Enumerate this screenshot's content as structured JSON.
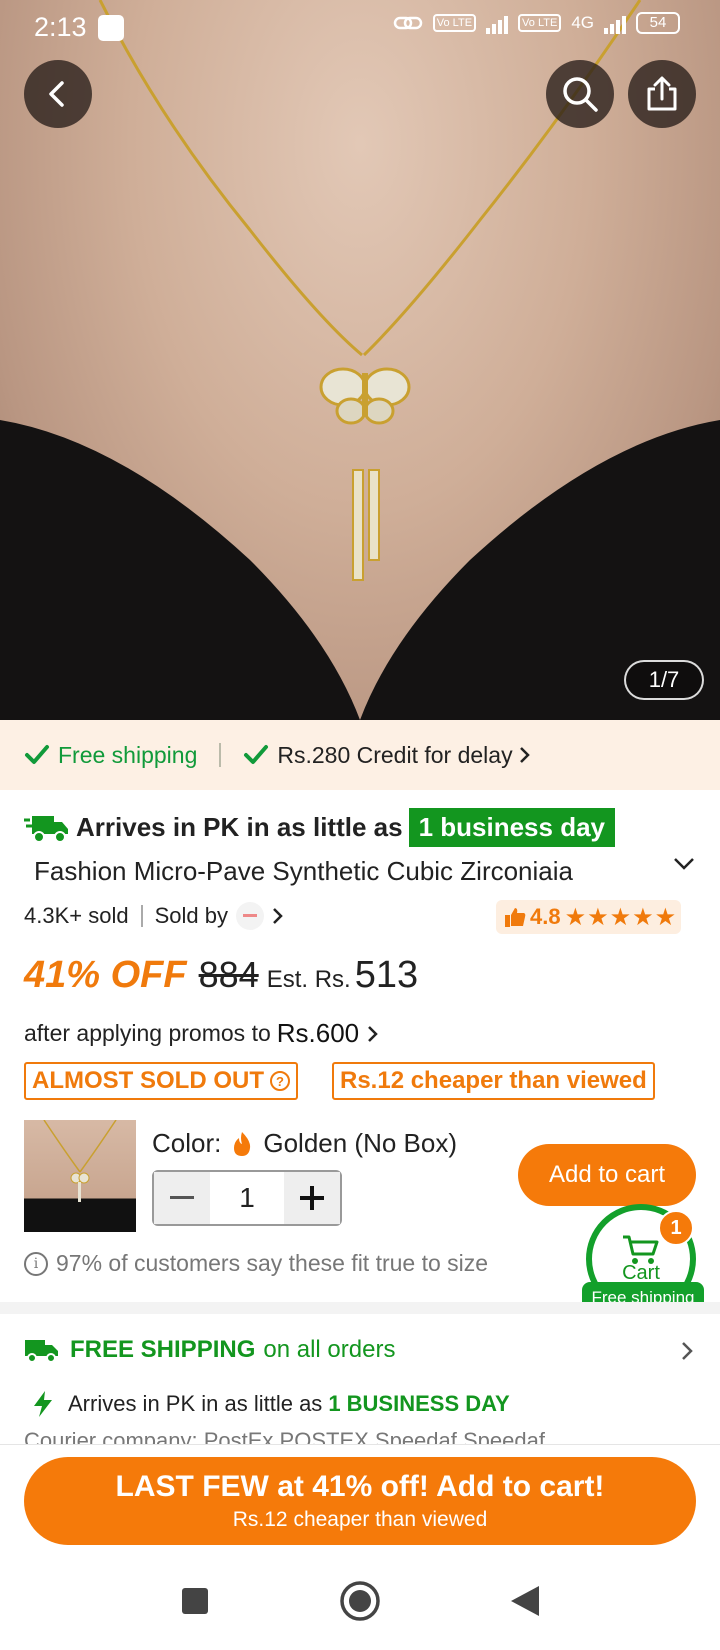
{
  "status_bar": {
    "time": "2:13",
    "battery": "54",
    "net_label_1": "Vo LTE",
    "net_label_2": "Vo LTE",
    "net_type": "4G"
  },
  "gallery": {
    "counter": "1/7"
  },
  "shipping_strip": {
    "free_shipping": "Free shipping",
    "credit": "Rs.280 Credit for delay"
  },
  "product": {
    "arrives_text": "Arrives in PK in as little as",
    "arrives_badge": "1 business day",
    "title": "Fashion Micro-Pave Synthetic Cubic Zirconiaia",
    "sold_count": "4.3K+ sold",
    "sold_by": "Sold by",
    "rating": "4.8",
    "stars": "★★★★★",
    "discount": "41% OFF",
    "original_price": "884",
    "est_label": "Est. Rs.",
    "current_price": "513",
    "promo_text": "after applying promos to",
    "promo_price": "Rs.600",
    "badge_almost": "ALMOST SOLD OUT",
    "badge_cheaper": "Rs.12 cheaper than viewed",
    "color_label": "Color:",
    "color_value": "Golden (No Box)",
    "quantity": "1",
    "add_to_cart": "Add to cart",
    "fit_note": "97% of customers say these fit true to size"
  },
  "cart": {
    "label": "Cart",
    "count": "1",
    "free_shipping": "Free shipping"
  },
  "shipping_section": {
    "free_bold": "FREE SHIPPING",
    "free_rest": "on all orders",
    "arrive_text": "Arrives in PK in as little as",
    "arrive_bold": "1 BUSINESS DAY",
    "courier": "Courier company: PostEx POSTEX Speedaf Speedaf"
  },
  "cta": {
    "line1": "LAST FEW at 41% off! Add to cart!",
    "line2": "Rs.12 cheaper than viewed"
  },
  "colors": {
    "accent": "#f57a0a",
    "green": "#13961f",
    "strip_bg": "#fdf0e4"
  }
}
